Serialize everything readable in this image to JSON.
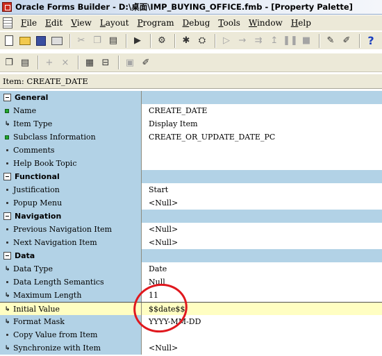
{
  "window": {
    "title": "Oracle Forms Builder - D:\\桌面\\IMP_BUYING_OFFICE.fmb - [Property Palette]"
  },
  "menu": [
    {
      "label": "File",
      "mnemonic": "F",
      "rest": "ile"
    },
    {
      "label": "Edit",
      "mnemonic": "E",
      "rest": "dit"
    },
    {
      "label": "View",
      "mnemonic": "V",
      "rest": "iew"
    },
    {
      "label": "Layout",
      "mnemonic": "L",
      "rest": "ayout"
    },
    {
      "label": "Program",
      "mnemonic": "P",
      "rest": "rogram"
    },
    {
      "label": "Debug",
      "mnemonic": "D",
      "rest": "ebug"
    },
    {
      "label": "Tools",
      "mnemonic": "T",
      "rest": "ools"
    },
    {
      "label": "Window",
      "mnemonic": "W",
      "rest": "indow"
    },
    {
      "label": "Help",
      "mnemonic": "H",
      "rest": "elp"
    }
  ],
  "toolbar2": {
    "add_glyph": "+",
    "remove_glyph": "×"
  },
  "item_label": "Item: CREATE_DATE",
  "sections": [
    {
      "title": "General",
      "rows": [
        {
          "name": "Name",
          "icon": "green-square",
          "value": "CREATE_DATE"
        },
        {
          "name": "Item Type",
          "icon": "arrow",
          "value": "Display Item"
        },
        {
          "name": "Subclass Information",
          "icon": "green-square",
          "value": "CREATE_OR_UPDATE_DATE_PC"
        },
        {
          "name": "Comments",
          "icon": "dot",
          "value": ""
        },
        {
          "name": "Help Book Topic",
          "icon": "dot",
          "value": ""
        }
      ]
    },
    {
      "title": "Functional",
      "rows": [
        {
          "name": "Justification",
          "icon": "dot",
          "value": "Start"
        },
        {
          "name": "Popup Menu",
          "icon": "dot",
          "value": "<Null>"
        }
      ]
    },
    {
      "title": "Navigation",
      "rows": [
        {
          "name": "Previous Navigation Item",
          "icon": "dot",
          "value": "<Null>"
        },
        {
          "name": "Next Navigation Item",
          "icon": "dot",
          "value": "<Null>"
        }
      ]
    },
    {
      "title": "Data",
      "rows": [
        {
          "name": "Data Type",
          "icon": "arrow",
          "value": "Date"
        },
        {
          "name": "Data Length Semantics",
          "icon": "dot",
          "value": "Null"
        },
        {
          "name": "Maximum Length",
          "icon": "arrow",
          "value": "11"
        },
        {
          "name": "Initial Value",
          "icon": "arrow",
          "value": "$$date$$",
          "selected": true
        },
        {
          "name": "Format Mask",
          "icon": "arrow",
          "value": "YYYY-MM-DD"
        },
        {
          "name": "Copy Value from Item",
          "icon": "dot",
          "value": ""
        },
        {
          "name": "Synchronize with Item",
          "icon": "arrow",
          "value": "<Null>"
        }
      ]
    }
  ],
  "colors": {
    "name_column": "#b2d2e6",
    "highlight_row": "#fffec2",
    "annotation": "#e0181e"
  }
}
